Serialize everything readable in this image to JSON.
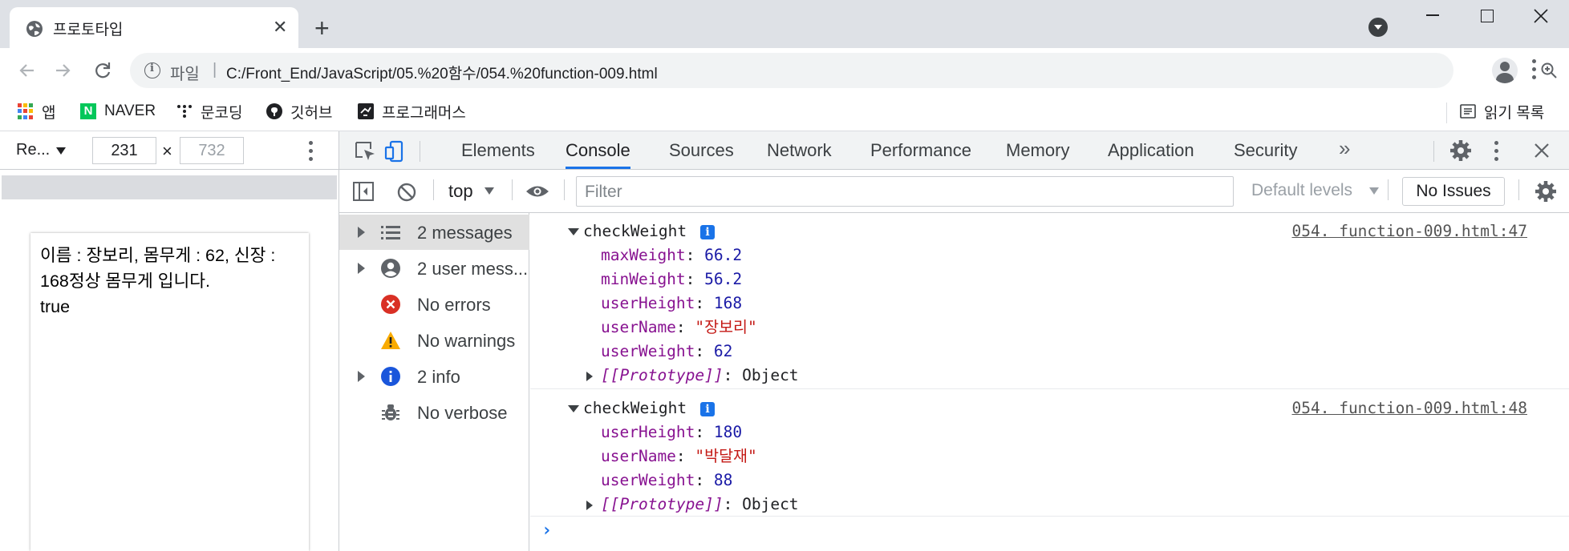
{
  "browser": {
    "tab": {
      "title": "프로토타입",
      "close": "✕"
    },
    "new_tab": "+",
    "toolbar": {
      "scheme_label": "파일",
      "url": "C:/Front_End/JavaScript/05.%20함수/054.%20function-009.html"
    },
    "bookmarks": [
      {
        "label": "앱",
        "icon": "apps-icon"
      },
      {
        "label": "NAVER",
        "icon": "naver-icon"
      },
      {
        "label": "문코딩",
        "icon": "moon-coding-icon"
      },
      {
        "label": "깃허브",
        "icon": "github-icon"
      },
      {
        "label": "프로그래머스",
        "icon": "programmers-icon"
      }
    ],
    "reading_list": "읽기 목록"
  },
  "device_toolbar": {
    "device": "Re...",
    "width": "231",
    "x": "×",
    "height": "732"
  },
  "viewport": {
    "lines": [
      "이름 : 장보리, 몸무게 : 62, 신장 : 168정상 몸무게 입니다.",
      "true"
    ]
  },
  "devtools": {
    "tabs": [
      "Elements",
      "Console",
      "Sources",
      "Network",
      "Performance",
      "Memory",
      "Application",
      "Security"
    ],
    "active_tab": "Console",
    "more": "»",
    "filterbar": {
      "context": "top",
      "filter_placeholder": "Filter",
      "levels": "Default levels",
      "issues": "No Issues"
    },
    "sidebar": [
      {
        "label": "2 messages",
        "icon": "list-icon",
        "expandable": true,
        "selected": true
      },
      {
        "label": "2 user mess...",
        "icon": "user-icon",
        "expandable": true,
        "selected": false
      },
      {
        "label": "No errors",
        "icon": "error-icon",
        "expandable": false,
        "selected": false
      },
      {
        "label": "No warnings",
        "icon": "warning-icon",
        "expandable": false,
        "selected": false
      },
      {
        "label": "2 info",
        "icon": "info-icon",
        "expandable": true,
        "selected": false
      },
      {
        "label": "No verbose",
        "icon": "bug-icon",
        "expandable": false,
        "selected": false
      }
    ],
    "console": {
      "entries": [
        {
          "name": "checkWeight",
          "source": "054. function-009.html:47",
          "props": [
            {
              "key": "maxWeight",
              "value": "66.2",
              "type": "num"
            },
            {
              "key": "minWeight",
              "value": "56.2",
              "type": "num"
            },
            {
              "key": "userHeight",
              "value": "168",
              "type": "num"
            },
            {
              "key": "userName",
              "value": "\"장보리\"",
              "type": "str"
            },
            {
              "key": "userWeight",
              "value": "62",
              "type": "num"
            }
          ],
          "proto_key": "[[Prototype]]",
          "proto_value": "Object"
        },
        {
          "name": "checkWeight",
          "source": "054. function-009.html:48",
          "props": [
            {
              "key": "userHeight",
              "value": "180",
              "type": "num"
            },
            {
              "key": "userName",
              "value": "\"박달재\"",
              "type": "str"
            },
            {
              "key": "userWeight",
              "value": "88",
              "type": "num"
            }
          ],
          "proto_key": "[[Prototype]]",
          "proto_value": "Object"
        }
      ],
      "prompt": "›"
    }
  },
  "colors": {
    "accent": "#1a73e8",
    "prop_key": "#881391",
    "prop_number": "#1a1aa6",
    "prop_string": "#c41a16",
    "error": "#d93025",
    "warning": "#f9ab00"
  }
}
